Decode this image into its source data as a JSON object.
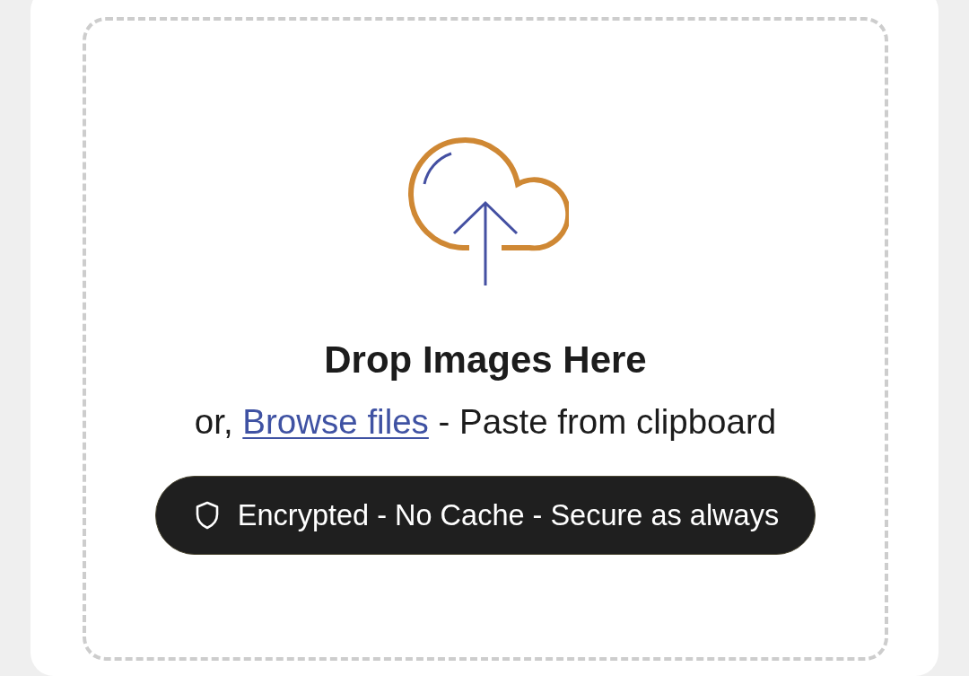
{
  "upload_area": {
    "title": "Drop Images Here",
    "instructions": {
      "prefix": "or,",
      "link": "Browse files",
      "suffix": "- Paste from clipboard"
    },
    "notice": "Encrypted - No Cache - Secure as always"
  }
}
